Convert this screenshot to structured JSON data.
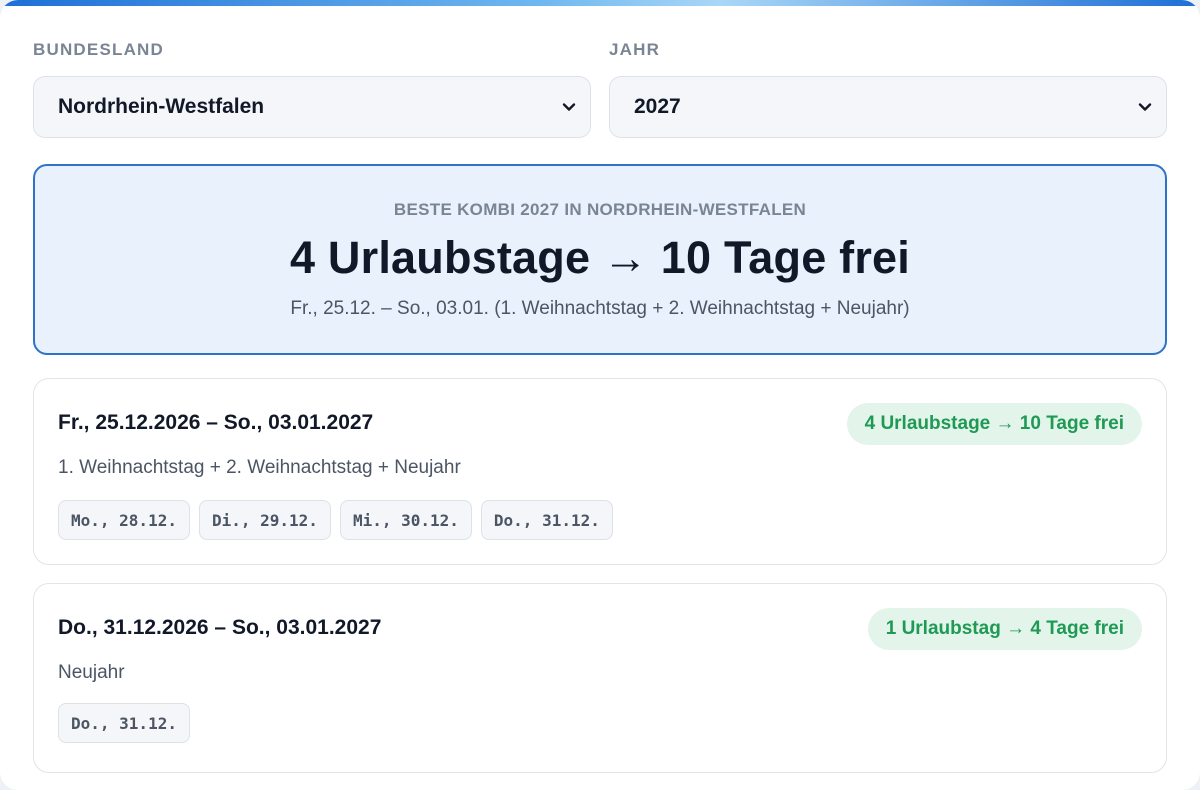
{
  "filters": {
    "state": {
      "label": "BUNDESLAND",
      "value": "Nordrhein-Westfalen"
    },
    "year": {
      "label": "JAHR",
      "value": "2027"
    }
  },
  "best_combo": {
    "eyebrow": "BESTE KOMBI 2027 IN NORDRHEIN-WESTFALEN",
    "headline": "4 Urlaubstage → 10 Tage frei",
    "detail": "Fr., 25.12. – So., 03.01. (1. Weihnachtstag + 2. Weihnachtstag + Neujahr)"
  },
  "options": [
    {
      "range": "Fr., 25.12.2026 – So., 03.01.2027",
      "holidays": "1. Weihnachtstag + 2. Weihnachtstag + Neujahr",
      "badge": "4 Urlaubstage → 10 Tage frei",
      "days": [
        "Mo., 28.12.",
        "Di., 29.12.",
        "Mi., 30.12.",
        "Do., 31.12."
      ]
    },
    {
      "range": "Do., 31.12.2026 – So., 03.01.2027",
      "holidays": "Neujahr",
      "badge": "1 Urlaubstag → 4 Tage frei",
      "days": [
        "Do., 31.12."
      ]
    }
  ],
  "colors": {
    "accent": "#2d74c9",
    "badge_text": "#1f9a55",
    "badge_bg": "#e3f4ea"
  },
  "icons": {
    "select_chevron": "chevron-down-icon"
  }
}
